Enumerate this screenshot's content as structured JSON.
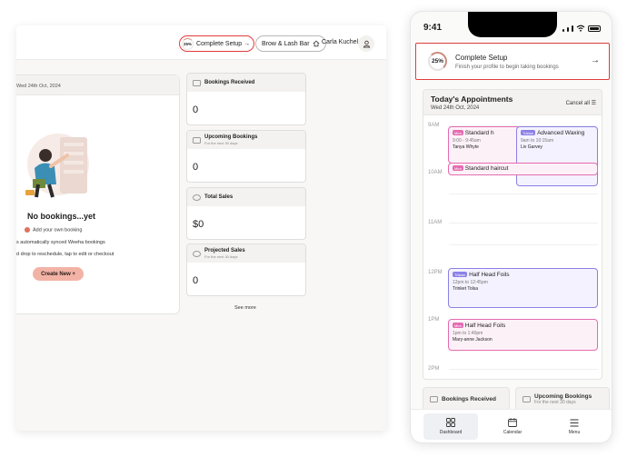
{
  "desktop": {
    "header": {
      "setup_percent": "25%",
      "setup_label": "Complete Setup →",
      "business_label": "Brow & Lash Bar",
      "user_name": "Carla Kuchel"
    },
    "empty_card": {
      "date": "Wed 24th Oct, 2024",
      "title": "No bookings...yet",
      "line1": "Add your own booking",
      "line2": "s automatically synced Weeha bookings",
      "line3": "d drop to reschedule, tap to edit or checkout",
      "create_label": "Create New +"
    },
    "stats": [
      {
        "title": "Bookings Received",
        "sub": "",
        "value": "0"
      },
      {
        "title": "Upcoming Bookings",
        "sub": "For the next 30 days",
        "value": "0"
      },
      {
        "title": "Total Sales",
        "sub": "",
        "value": "$0"
      },
      {
        "title": "Projected Sales",
        "sub": "For the next 30 days",
        "value": "0"
      }
    ],
    "see_more": "See more"
  },
  "phone": {
    "time": "9:41",
    "setup": {
      "percent": "25%",
      "title": "Complete Setup",
      "sub": "Finish your profile to begin taking bookings",
      "arrow": "→"
    },
    "appointments": {
      "title": "Today's Appointments",
      "date": "Wed 24th Oct, 2024",
      "cancel_all": "Cancel all",
      "hours": [
        "9AM",
        "10AM",
        "11AM",
        "12PM",
        "1PM",
        "2PM"
      ],
      "events": [
        {
          "tag": "Mira",
          "title": "Standard h",
          "time": "9:00 - 9:45am",
          "client": "Tanya Whyte"
        },
        {
          "tag": "Tristan",
          "title": "Advanced Waxing",
          "time": "9am to 10:15am",
          "client": "Liv Garvey"
        },
        {
          "tag": "Mira",
          "title": "Standard haircut",
          "time": "",
          "client": ""
        },
        {
          "tag": "Tristan",
          "title": "Half Head Foils",
          "time": "12pm to 12:45pm",
          "client": "Trinket Tolsa"
        },
        {
          "tag": "Mira",
          "title": "Half Head Foils",
          "time": "1pm to 1:40pm",
          "client": "Mary-anne Jackson"
        }
      ]
    },
    "mini_stats": [
      {
        "title": "Bookings Received",
        "sub": ""
      },
      {
        "title": "Upcoming Bookings",
        "sub": "For the next 30 days"
      }
    ],
    "tabs": [
      "Dashboard",
      "Calendar",
      "Menu"
    ]
  }
}
